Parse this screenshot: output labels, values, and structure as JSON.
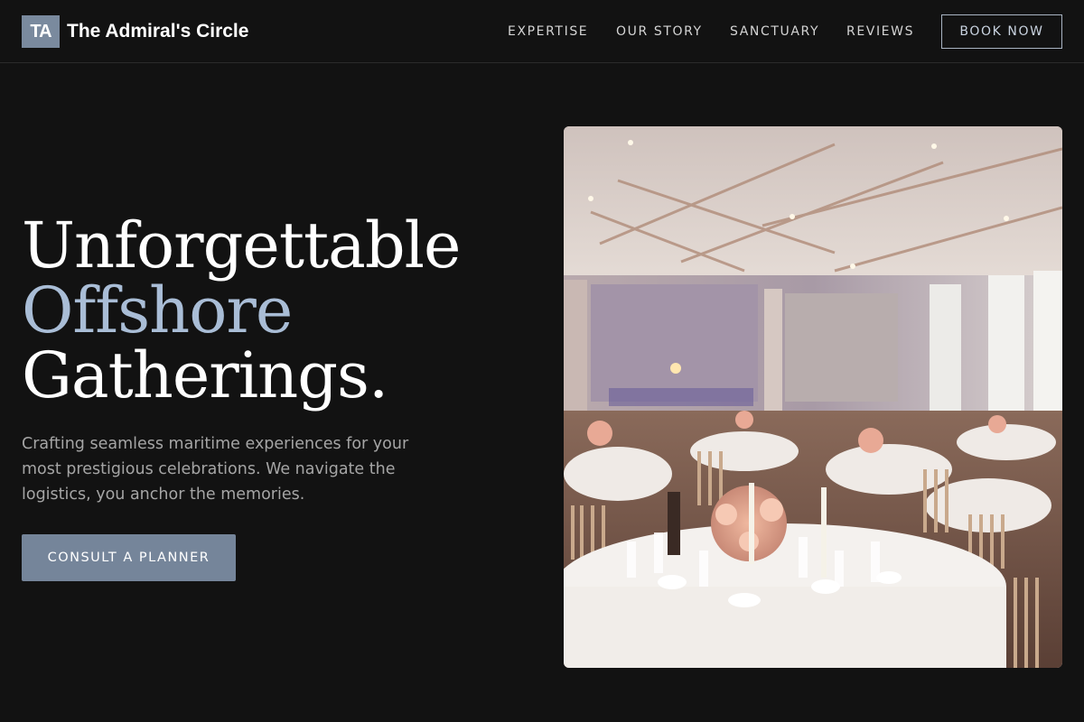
{
  "brand": {
    "badge": "TA",
    "name": "The Admiral's Circle"
  },
  "nav": {
    "links": [
      "EXPERTISE",
      "OUR STORY",
      "SANCTUARY",
      "REVIEWS"
    ],
    "book_label": "BOOK NOW"
  },
  "hero": {
    "title_line1": "Unforgettable",
    "title_line2": "Offshore",
    "title_line3": "Gatherings.",
    "subtitle": "Crafting seamless maritime experiences for your most prestigious celebrations. We navigate the logistics, you anchor the memories.",
    "cta_label": "CONSULT A PLANNER"
  },
  "colors": {
    "background": "#121212",
    "accent": "#a9bdd6",
    "button": "#75859a",
    "badge": "#7a8a9e"
  }
}
